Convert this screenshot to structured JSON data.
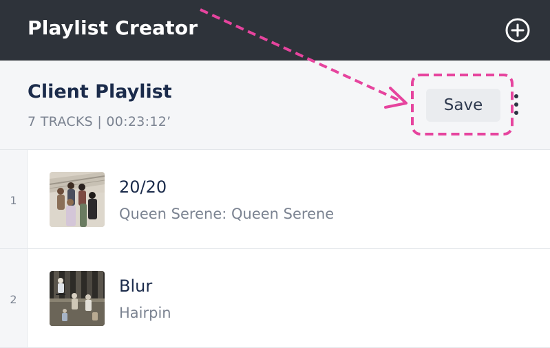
{
  "app": {
    "title": "Playlist Creator",
    "add_icon": "plus-circle-icon"
  },
  "playlist": {
    "name": "Client Playlist",
    "meta": "7 TRACKS | 00:23:12’",
    "save_label": "Save",
    "more_icon": "vertical-ellipsis-icon"
  },
  "tracks": [
    {
      "number": "1",
      "title": "20/20",
      "artist": "Queen Serene: Queen Serene",
      "art": "album-art-band-on-stairs"
    },
    {
      "number": "2",
      "title": "Blur",
      "artist": "Hairpin",
      "art": "album-art-skateboard-night"
    }
  ],
  "colors": {
    "topbar": "#2e333a",
    "header_bg": "#f5f6f8",
    "title_text": "#1b2b4b",
    "muted_text": "#7b8391",
    "annotation": "#e6449e"
  }
}
